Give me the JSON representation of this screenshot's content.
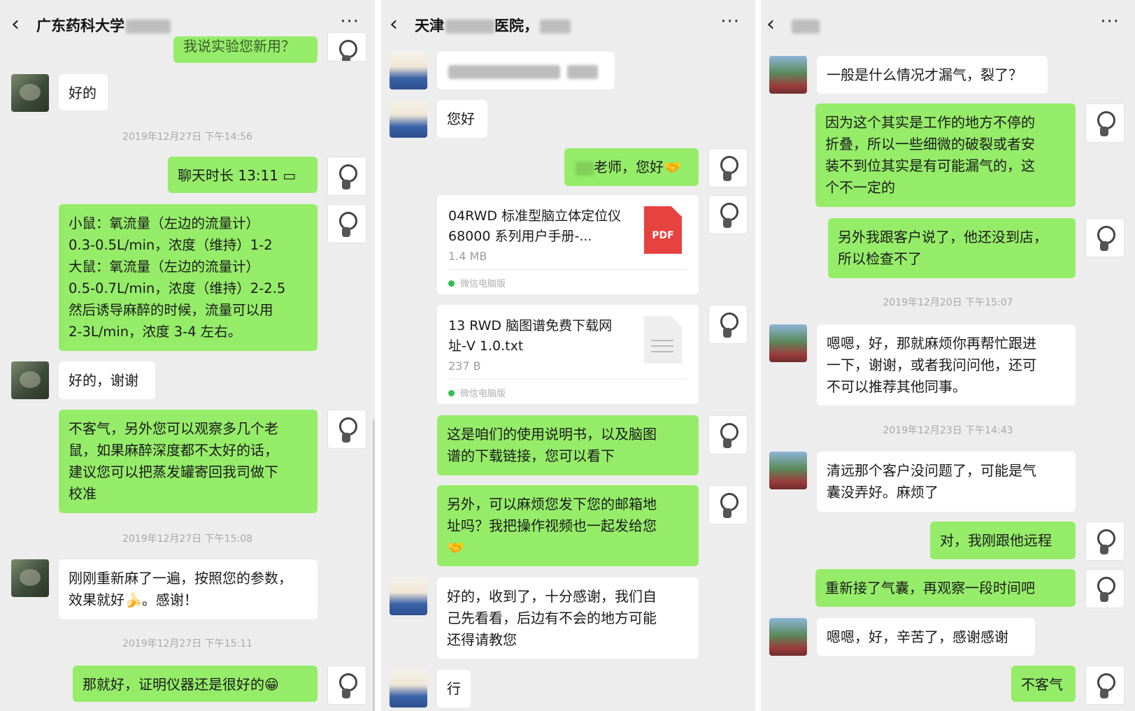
{
  "panel1": {
    "title": "广东药科大学",
    "msg_top": "我说实验您新用？",
    "msg_ok": "好的",
    "ts1": "2019年12月27日 下午14:56",
    "call": "聊天时长 13:11",
    "msg_oxygen": "小鼠：氧流量（左边的流量计）\n0.3-0.5L/min，浓度（维持）1-2\n大鼠：氧流量（左边的流量计）\n0.5-0.7L/min，浓度（维持）2-2.5\n然后诱导麻醉的时候，流量可以用\n2-3L/min，浓度 3-4 左右。",
    "msg_thanks": "好的，谢谢",
    "msg_welcome": "不客气，另外您可以观察多几个老\n鼠，如果麻醉深度都不太好的话，\n建议您可以把蒸发罐寄回我司做下\n校准",
    "ts2": "2019年12月27日 下午15:08",
    "msg_redo": "刚刚重新麻了一遍，按照您的参数，\n效果就好🍌。感谢！",
    "ts3": "2019年12月27日 下午15:11",
    "msg_good": "那就好，证明仪器还是很好的😁"
  },
  "panel2": {
    "title": "天津",
    "title_b": "医院，",
    "msg_hi": "您好",
    "msg_teacher": "老师，您好🤝",
    "file1_name": "04RWD 标准型脑立体定位仪 68000 系列用户手册-...",
    "file1_size": "1.4 MB",
    "file1_type": "PDF",
    "file_src": "微信电脑版",
    "file2_name": "13 RWD 脑图谱免费下载网址-V 1.0.txt",
    "file2_size": "237 B",
    "msg_manual": "这是咱们的使用说明书，以及脑图\n谱的下载链接，您可以看下",
    "msg_email": "另外，可以麻烦您发下您的邮箱地\n址吗？我把操作视频也一起发给您\n🤝",
    "msg_received": "好的，收到了，十分感谢，我们自\n己先看看，后边有不会的地方可能\n还得请教您",
    "msg_ok": "行"
  },
  "panel3": {
    "msg_leak": "一般是什么情况才漏气，裂了？",
    "msg_because": "因为这个其实是工作的地方不停的\n折叠，所以一些细微的破裂或者安\n装不到位其实是有可能漏气的，这\n个不一定的",
    "msg_customer": "另外我跟客户说了，他还没到店，\n所以检查不了",
    "ts1": "2019年12月20日 下午15:07",
    "msg_follow": "嗯嗯，好，那就麻烦你再帮忙跟进\n一下，谢谢，或者我问问他，还可\n不可以推荐其他同事。",
    "ts2": "2019年12月23日 下午14:43",
    "msg_fine": "清远那个客户没问题了，可能是气\n囊没弄好。麻烦了",
    "msg_remote": "对，我刚跟他远程",
    "msg_reconnect": "重新接了气囊，再观察一段时间吧",
    "msg_thanks": "嗯嗯，好，辛苦了，感谢感谢",
    "msg_welcome": "不客气"
  },
  "icons": {
    "back": "‹",
    "more": "···"
  }
}
